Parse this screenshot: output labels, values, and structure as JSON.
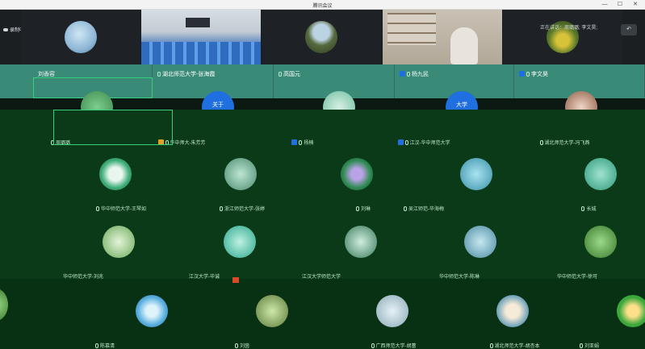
{
  "window": {
    "title": "腾讯会议",
    "minimize": "—",
    "maximize": "☐",
    "close": "✕"
  },
  "recording": {
    "label": "录制中"
  },
  "speaking": {
    "label": "正在讲话：周璐璐; 李文昊;"
  },
  "collapse_label": "↶",
  "top_names": [
    {
      "name": "刘香容",
      "mic": false
    },
    {
      "name": "湖北师范大学-张海霞",
      "mic": true
    },
    {
      "name": "高国元",
      "mic": true
    },
    {
      "name": "杨九民",
      "mic": true
    },
    {
      "name": "李文昊",
      "mic": true
    }
  ],
  "overlay_names": [
    "关于",
    "大学"
  ],
  "rows": [
    [
      {
        "name": "周璐璐"
      },
      {
        "name": "华中师大-朱芳芳",
        "badge": "#e0a020"
      },
      {
        "name": "杨楠",
        "badge": "#1f6fe0"
      },
      {
        "name": "江汉-华中师范大学",
        "badge": "#1f6fe0"
      },
      {
        "name": "湖北师范大学-冯飞燕"
      }
    ],
    [
      {
        "name": "华中师范大学-王琴如"
      },
      {
        "name": "浙江师范大学-张婷"
      },
      {
        "name": "刘琳"
      },
      {
        "name": "吴江师范-毕海梅"
      },
      {
        "name": "长城"
      }
    ],
    [
      {
        "name": "华中师范大学-刘兆"
      },
      {
        "name": "江汉大学-毕诚"
      },
      {
        "name": "江汉大学师范大学"
      },
      {
        "name": "华中师范大学-陈琳"
      },
      {
        "name": "华中师范大学-徐可"
      }
    ],
    [
      {
        "name": "陈慕清"
      },
      {
        "name": "刘茵"
      },
      {
        "name": "广西师范大学-胡蕾"
      },
      {
        "name": "湖北师范大学-胡杏本"
      },
      {
        "name": "刘亚娟"
      }
    ]
  ],
  "colors": {
    "background": "#0a3a17",
    "accent_green": "#34d07a",
    "label_band": "#3a8a78"
  }
}
